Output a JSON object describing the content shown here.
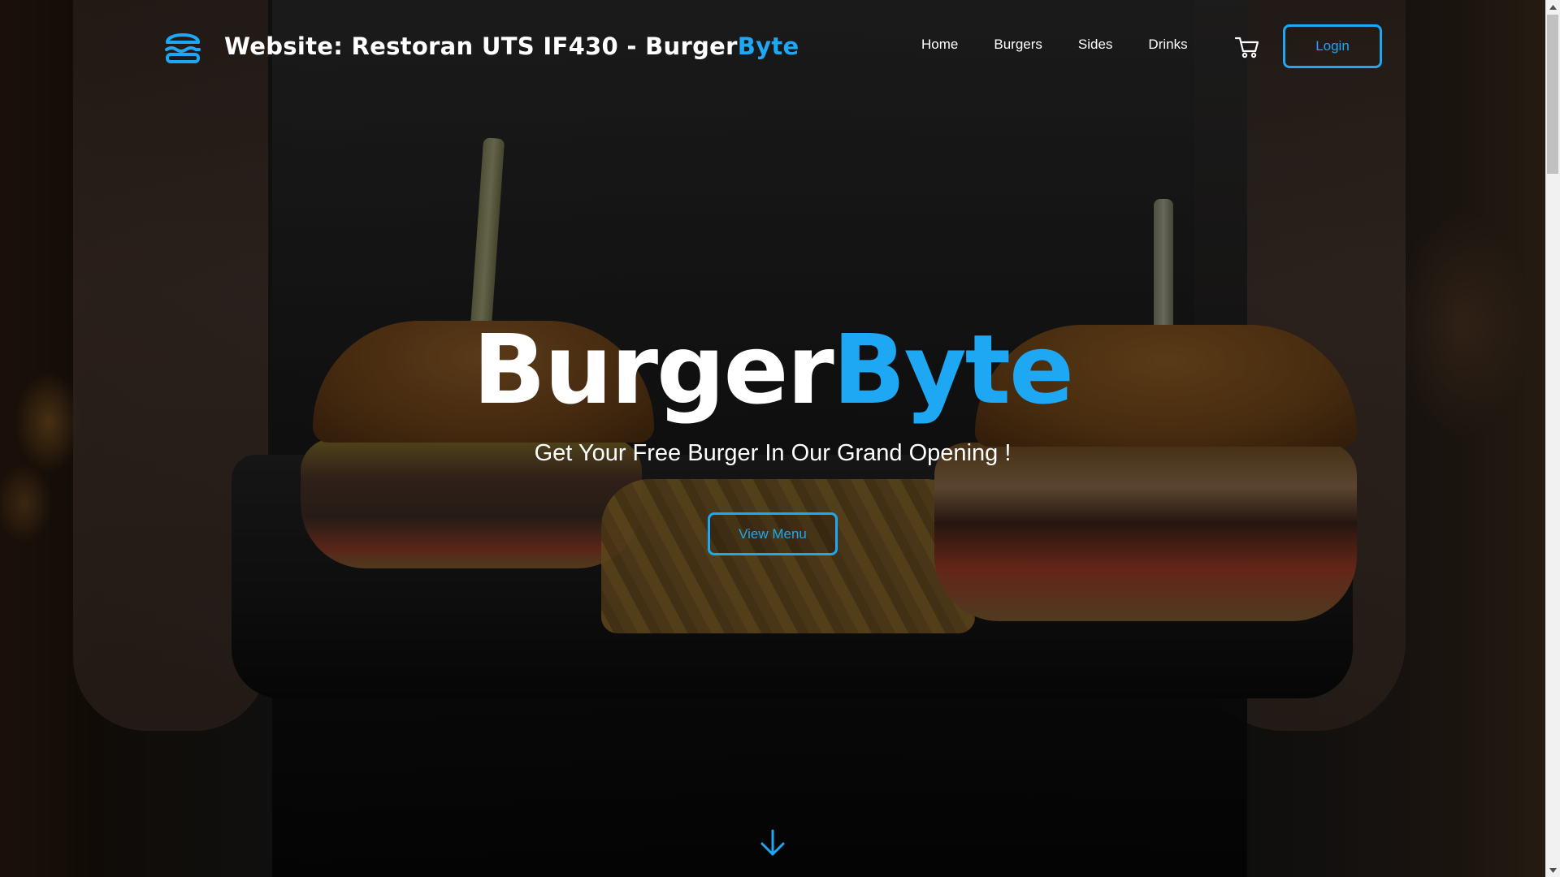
{
  "navbar": {
    "brand_prefix": "Website: Restoran UTS IF430 - Burger",
    "brand_accent": "Byte",
    "logo_icon": "hamburger-icon",
    "links": [
      {
        "label": "Home"
      },
      {
        "label": "Burgers"
      },
      {
        "label": "Sides"
      },
      {
        "label": "Drinks"
      }
    ],
    "cart_icon": "shopping-cart-icon",
    "login_label": "Login"
  },
  "hero": {
    "title_main": "Burger",
    "title_accent": "Byte",
    "subtitle": "Get Your Free Burger In Our Grand Opening !",
    "cta_label": "View Menu",
    "scroll_icon": "arrow-down-icon"
  },
  "colors": {
    "accent": "#1ea7f2",
    "text": "#ffffff",
    "background": "#0b0b0b"
  }
}
